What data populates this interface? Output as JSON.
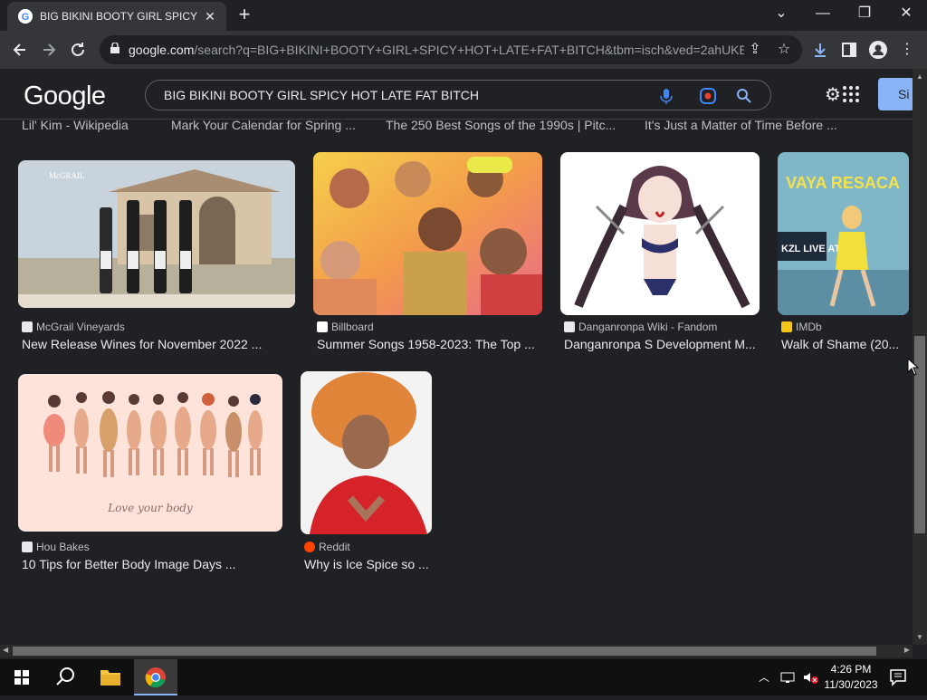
{
  "browser": {
    "tab_title": "BIG BIKINI BOOTY GIRL SPICY H...",
    "tab_close": "✕",
    "new_tab": "+",
    "window": {
      "minimize": "—",
      "restore": "❐",
      "close": "✕",
      "chevron": "⌄"
    },
    "url_domain": "google.com",
    "url_rest": "/search?q=BIG+BIKINI+BOOTY+GIRL+SPICY+HOT+LATE+FAT+BITCH&tbm=isch&ved=2ahUKE..."
  },
  "google": {
    "logo": "Google",
    "query": "BIG BIKINI BOOTY GIRL SPICY HOT LATE FAT BITCH",
    "signin_label": "Si"
  },
  "top_row_titles": [
    "Lil' Kim - Wikipedia",
    "Mark Your Calendar for Spring ...",
    "The 250 Best Songs of the 1990s | Pitc...",
    "It's Just a Matter of Time Before ..."
  ],
  "results": [
    {
      "source": "McGrail Vineyards",
      "title": "New Release Wines for November 2022 ...",
      "fav_color": "#e8eaed",
      "icon": "page-icon"
    },
    {
      "source": "Billboard",
      "title": "Summer Songs 1958-2023: The Top ...",
      "fav_color": "#ffffff",
      "icon": "billboard-icon"
    },
    {
      "source": "Danganronpa Wiki - Fandom",
      "title": "Danganronpa S Development M...",
      "fav_color": "#e8eaed",
      "icon": "fandom-icon"
    },
    {
      "source": "IMDb",
      "title": "Walk of Shame (20...",
      "fav_color": "#f5c518",
      "icon": "imdb-icon"
    },
    {
      "source": "Hou Bakes",
      "title": "10 Tips for Better Body Image Days ...",
      "fav_color": "#e8eaed",
      "icon": "page-icon"
    },
    {
      "source": "Reddit",
      "title": "Why is Ice Spice so ...",
      "fav_color": "#ff4500",
      "icon": "reddit-icon"
    }
  ],
  "thumbnail_text": {
    "vineyard_brand": "McGRAIL",
    "movie_title": "VAYA RESACA",
    "movie_tag": "KZL LIVE AT",
    "body_caption": "Love your body"
  },
  "taskbar": {
    "time": "4:26 PM",
    "date": "11/30/2023"
  }
}
